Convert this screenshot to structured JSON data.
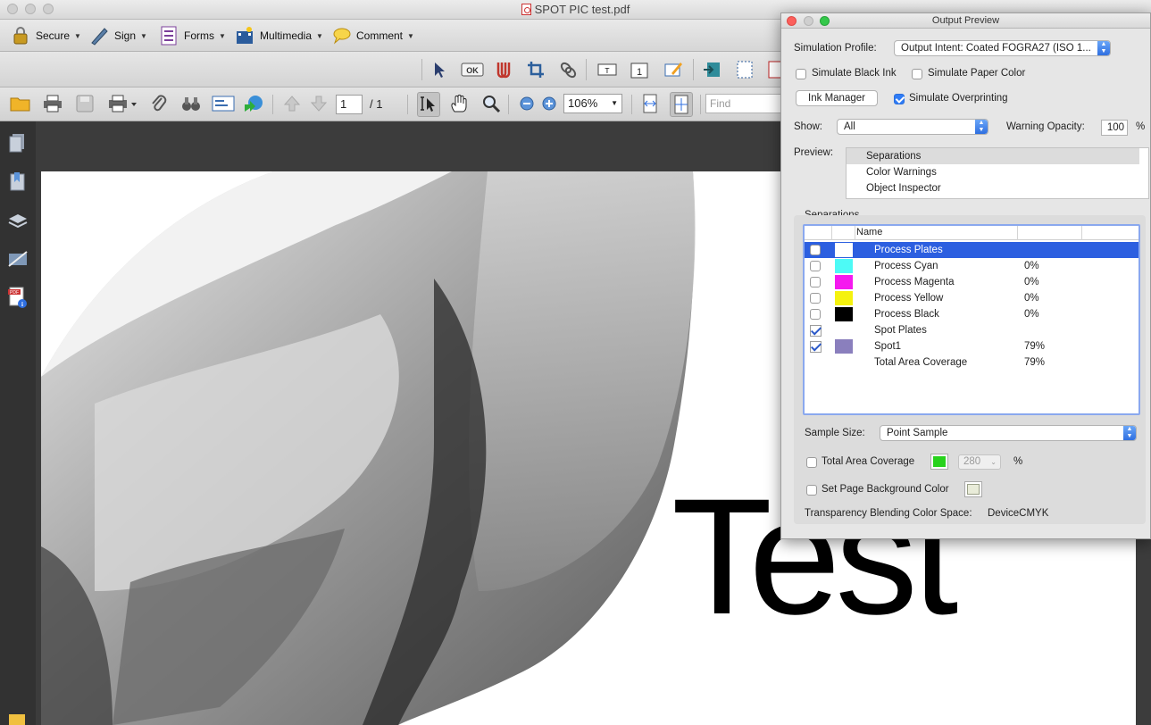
{
  "window": {
    "title": "SPOT PIC test.pdf"
  },
  "toolbar1": {
    "secure": "Secure",
    "sign": "Sign",
    "forms": "Forms",
    "multimedia": "Multimedia",
    "comment": "Comment"
  },
  "toolbar3": {
    "page_current": "1",
    "page_total": "/ 1",
    "zoom": "106%",
    "find_placeholder": "Find"
  },
  "document": {
    "text": "Test"
  },
  "panel": {
    "title": "Output Preview",
    "simulation_profile_label": "Simulation Profile:",
    "simulation_profile_value": "Output Intent: Coated FOGRA27 (ISO 1...",
    "simulate_black_ink": "Simulate Black Ink",
    "simulate_paper_color": "Simulate Paper Color",
    "ink_manager": "Ink Manager",
    "simulate_overprinting": "Simulate Overprinting",
    "show_label": "Show:",
    "show_value": "All",
    "warning_opacity_label": "Warning Opacity:",
    "warning_opacity_value": "100",
    "percent": "%",
    "preview_label": "Preview:",
    "preview_items": [
      "Separations",
      "Color Warnings",
      "Object Inspector"
    ],
    "separations_label": "Separations",
    "name_header": "Name",
    "rows": [
      {
        "name": "Process Plates",
        "pct": "",
        "swatch": "#ffffff"
      },
      {
        "name": "Process Cyan",
        "pct": "0%",
        "swatch": "#4dfaf6"
      },
      {
        "name": "Process Magenta",
        "pct": "0%",
        "swatch": "#f519ef"
      },
      {
        "name": "Process Yellow",
        "pct": "0%",
        "swatch": "#f5f20f"
      },
      {
        "name": "Process Black",
        "pct": "0%",
        "swatch": "#000000"
      },
      {
        "name": "Spot Plates",
        "pct": "",
        "swatch": ""
      },
      {
        "name": "Spot1",
        "pct": "79%",
        "swatch": "#8a7fbd"
      },
      {
        "name": "Total Area Coverage",
        "pct": "79%",
        "swatch": ""
      }
    ],
    "sample_size_label": "Sample Size:",
    "sample_size_value": "Point Sample",
    "total_area_coverage": "Total Area Coverage",
    "tac_color": "#27d21c",
    "tac_value": "280",
    "set_page_bg": "Set Page Background Color",
    "page_bg_color": "#e9ecd9",
    "blend_label": "Transparency Blending Color Space:",
    "blend_value": "DeviceCMYK"
  },
  "colors": {
    "accent": "#2f7cf6",
    "highlight_row": "#2c5fe0"
  }
}
